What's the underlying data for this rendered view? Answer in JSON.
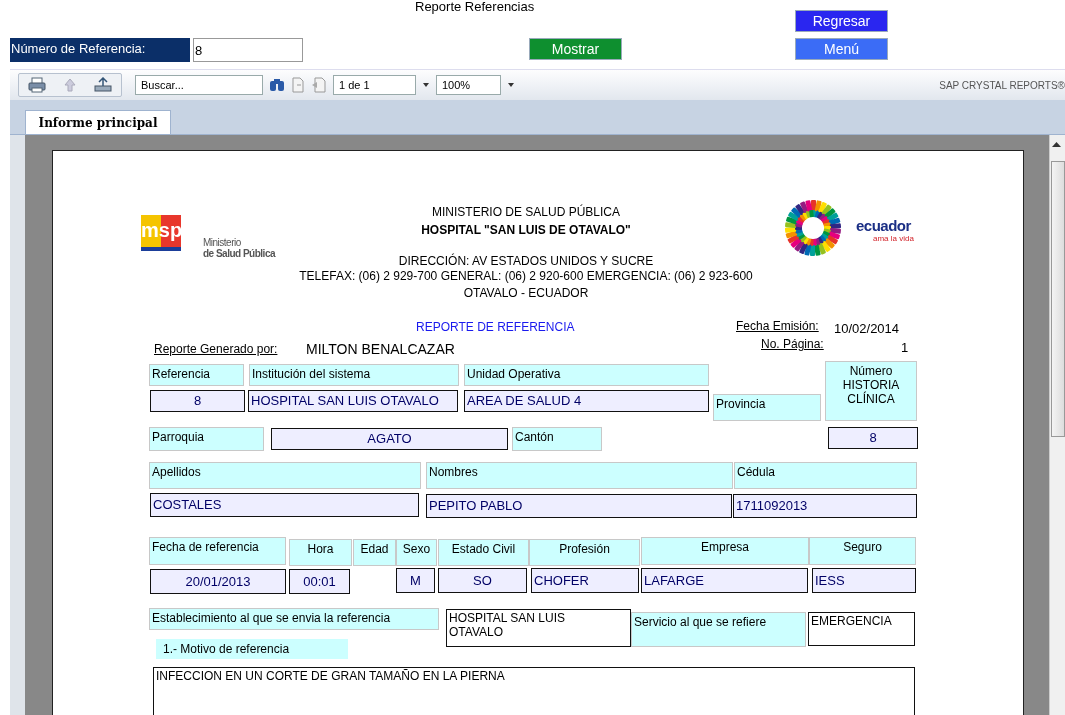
{
  "window": {
    "title": "Reporte Referencias"
  },
  "reference_search": {
    "label": "Número de Referencia:",
    "value": "8"
  },
  "back_button": {
    "label": "Regresar"
  },
  "show_button": {
    "label": "Mostrar"
  },
  "menu_button": {
    "label": "Menú"
  },
  "toolbar": {
    "search": {
      "value": "Buscar..."
    },
    "page": {
      "value": "1 de 1"
    },
    "zoom": {
      "value": "100%"
    },
    "brand": "SAP CRYSTAL REPORTS®"
  },
  "tabs": [
    {
      "label": "Informe principal",
      "selected": true
    }
  ],
  "report": {
    "msp_logo": {
      "mark": "msp",
      "line1": "Ministerio",
      "line2": "de Salud Pública"
    },
    "country_logo": {
      "word": "ecuador",
      "tagline": "ama la vida"
    },
    "header": [
      "MINISTERIO DE SALUD PÚBLICA",
      "HOSPITAL \"SAN LUIS DE OTAVALO\"",
      "DIRECCIÓN: AV ESTADOS UNIDOS Y SUCRE",
      "TELEFAX: (06) 2 929-700   GENERAL: (06) 2 920-600   EMERGENCIA: (06) 2 923-600",
      "OTAVALO - ECUADOR"
    ],
    "title": "REPORTE  DE REFERENCIA",
    "issue_date": {
      "label": "Fecha Emisión:",
      "value": "10/02/2014"
    },
    "page_number": {
      "label": "No. Página:",
      "value": "1"
    },
    "generated_by": {
      "label": "Reporte Generado por:",
      "value": "MILTON BENALCAZAR"
    },
    "fields": [
      {
        "kind": "label",
        "text": "Referencia"
      },
      {
        "kind": "label",
        "text": "Institución del sistema"
      },
      {
        "kind": "label",
        "text": "Unidad Operativa"
      },
      {
        "kind": "value",
        "text": "8"
      },
      {
        "kind": "value",
        "text": "HOSPITAL SAN LUIS OTAVALO"
      },
      {
        "kind": "value",
        "text": "AREA DE SALUD 4"
      },
      {
        "kind": "label",
        "text": "Provincia"
      },
      {
        "kind": "label",
        "text": "Número HISTORIA CLÍNICA"
      },
      {
        "kind": "label",
        "text": "Parroquia"
      },
      {
        "kind": "value",
        "text": "AGATO"
      },
      {
        "kind": "label",
        "text": "Cantón"
      },
      {
        "kind": "value",
        "text": "8"
      },
      {
        "kind": "label",
        "text": "Apellidos"
      },
      {
        "kind": "label",
        "text": "Nombres"
      },
      {
        "kind": "label",
        "text": "Cédula"
      },
      {
        "kind": "value",
        "text": "COSTALES"
      },
      {
        "kind": "value",
        "text": "PEPITO PABLO"
      },
      {
        "kind": "value",
        "text": "1711092013"
      },
      {
        "kind": "label",
        "text": "Fecha de referencia"
      },
      {
        "kind": "label",
        "text": "Hora"
      },
      {
        "kind": "label",
        "text": "Edad"
      },
      {
        "kind": "label",
        "text": "Sexo"
      },
      {
        "kind": "label",
        "text": "Estado Civil"
      },
      {
        "kind": "label",
        "text": "Profesión"
      },
      {
        "kind": "label",
        "text": "Empresa"
      },
      {
        "kind": "label",
        "text": "Seguro"
      },
      {
        "kind": "value",
        "text": "20/01/2013"
      },
      {
        "kind": "value",
        "text": "00:01"
      },
      {
        "kind": "value",
        "text": "M"
      },
      {
        "kind": "value",
        "text": "SO"
      },
      {
        "kind": "value",
        "text": "CHOFER"
      },
      {
        "kind": "value",
        "text": "LAFARGE"
      },
      {
        "kind": "value",
        "text": "IESS"
      },
      {
        "kind": "label",
        "text": "Establecimiento al que se envia la referencia"
      },
      {
        "kind": "box",
        "text": "HOSPITAL SAN LUIS OTAVALO"
      },
      {
        "kind": "label",
        "text": "Servicio al que se refiere"
      },
      {
        "kind": "box",
        "text": "EMERGENCIA"
      },
      {
        "kind": "label",
        "text": "1.- Motivo de referencia"
      },
      {
        "kind": "box",
        "text": "INFECCION EN UN CORTE DE GRAN TAMAÑO EN LA PIERNA"
      }
    ]
  }
}
